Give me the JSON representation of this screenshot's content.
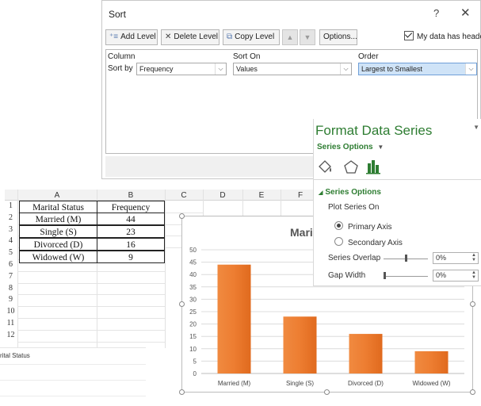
{
  "sort_dialog": {
    "title": "Sort",
    "help": "?",
    "close": "✕",
    "add_level": "Add Level",
    "delete_level": "Delete Level",
    "copy_level": "Copy Level",
    "options": "Options...",
    "my_data_has_headers": "My data has headers",
    "headers_checked": true,
    "column_header": "Column",
    "sort_on_header": "Sort On",
    "order_header": "Order",
    "sort_by_label": "Sort by",
    "column_value": "Frequency",
    "sort_on_value": "Values",
    "order_value": "Largest to Smallest"
  },
  "sheet": {
    "columns": [
      "A",
      "B",
      "C",
      "D",
      "E",
      "F"
    ],
    "rows": [
      "1",
      "2",
      "3",
      "4",
      "5",
      "6",
      "7",
      "8",
      "9",
      "10",
      "11",
      "12"
    ],
    "table": {
      "headers": [
        "Marital Status",
        "Frequency"
      ],
      "rows": [
        [
          "Married (M)",
          "44"
        ],
        [
          "Single (S)",
          "23"
        ],
        [
          "Divorced (D)",
          "16"
        ],
        [
          "Widowed (W)",
          "9"
        ]
      ]
    },
    "lower_label": "rital Status"
  },
  "chart_data": {
    "type": "bar",
    "title": "Mari",
    "categories": [
      "Married (M)",
      "Single (S)",
      "Divorced (D)",
      "Widowed (W)"
    ],
    "values": [
      44,
      23,
      16,
      9
    ],
    "ylim": [
      0,
      50
    ],
    "yticks": [
      "0",
      "5",
      "10",
      "15",
      "20",
      "25",
      "30",
      "35",
      "40",
      "45",
      "50"
    ],
    "grid": true,
    "bar_color": "#ed7d31"
  },
  "format_pane": {
    "title": "Format Data Series",
    "series_options_dropdown": "Series Options",
    "section": "Series Options",
    "plot_series_on": "Plot Series On",
    "primary_axis": "Primary Axis",
    "secondary_axis": "Secondary Axis",
    "primary_selected": true,
    "series_overlap_label": "Series Overlap",
    "series_overlap_value": "0%",
    "gap_width_label": "Gap Width",
    "gap_width_value": "0%",
    "accent_color": "#2e7d32"
  }
}
